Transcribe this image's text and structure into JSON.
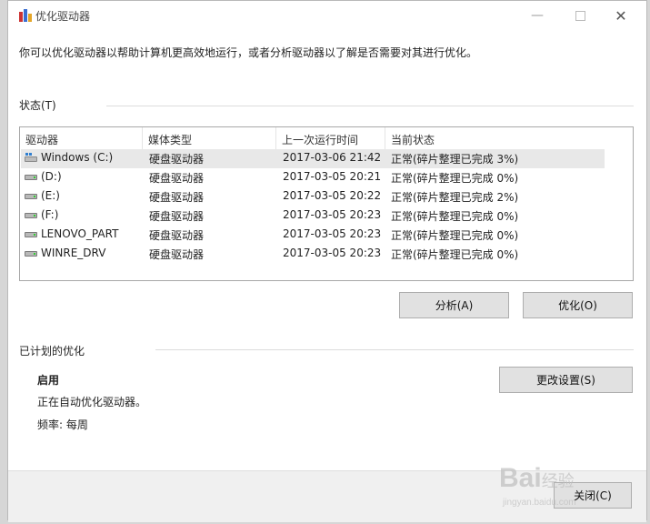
{
  "window": {
    "title": "优化驱动器"
  },
  "description": "你可以优化驱动器以帮助计算机更高效地运行，或者分析驱动器以了解是否需要对其进行优化。",
  "status_section": {
    "label": "状态(T)",
    "columns": [
      "驱动器",
      "媒体类型",
      "上一次运行时间",
      "当前状态"
    ],
    "rows": [
      {
        "drive": "Windows (C:)",
        "media": "硬盘驱动器",
        "last_run": "2017-03-06 21:42",
        "status": "正常(碎片整理已完成 3%)",
        "icon": "os-drive-icon"
      },
      {
        "drive": "(D:)",
        "media": "硬盘驱动器",
        "last_run": "2017-03-05 20:21",
        "status": "正常(碎片整理已完成 0%)",
        "icon": "hard-drive-icon"
      },
      {
        "drive": "(E:)",
        "media": "硬盘驱动器",
        "last_run": "2017-03-05 20:22",
        "status": "正常(碎片整理已完成 2%)",
        "icon": "hard-drive-icon"
      },
      {
        "drive": "(F:)",
        "media": "硬盘驱动器",
        "last_run": "2017-03-05 20:23",
        "status": "正常(碎片整理已完成 0%)",
        "icon": "hard-drive-icon"
      },
      {
        "drive": "LENOVO_PART",
        "media": "硬盘驱动器",
        "last_run": "2017-03-05 20:23",
        "status": "正常(碎片整理已完成 0%)",
        "icon": "hard-drive-icon"
      },
      {
        "drive": "WINRE_DRV",
        "media": "硬盘驱动器",
        "last_run": "2017-03-05 20:23",
        "status": "正常(碎片整理已完成 0%)",
        "icon": "hard-drive-icon"
      }
    ],
    "analyze_label": "分析(A)",
    "optimize_label": "优化(O)"
  },
  "scheduled_section": {
    "label": "已计划的优化",
    "state": "启用",
    "detail": "正在自动优化驱动器。",
    "frequency": "频率: 每周",
    "change_settings_label": "更改设置(S)"
  },
  "footer": {
    "close_label": "关闭(C)"
  },
  "watermark": {
    "brand": "Bai",
    "brand_suffix": "经验",
    "url": "jingyan.baidu.com"
  },
  "colors": {
    "selected_row": "#e8e8e8",
    "button_bg": "#e1e1e1",
    "accent_icon": "#2f7fd0"
  }
}
